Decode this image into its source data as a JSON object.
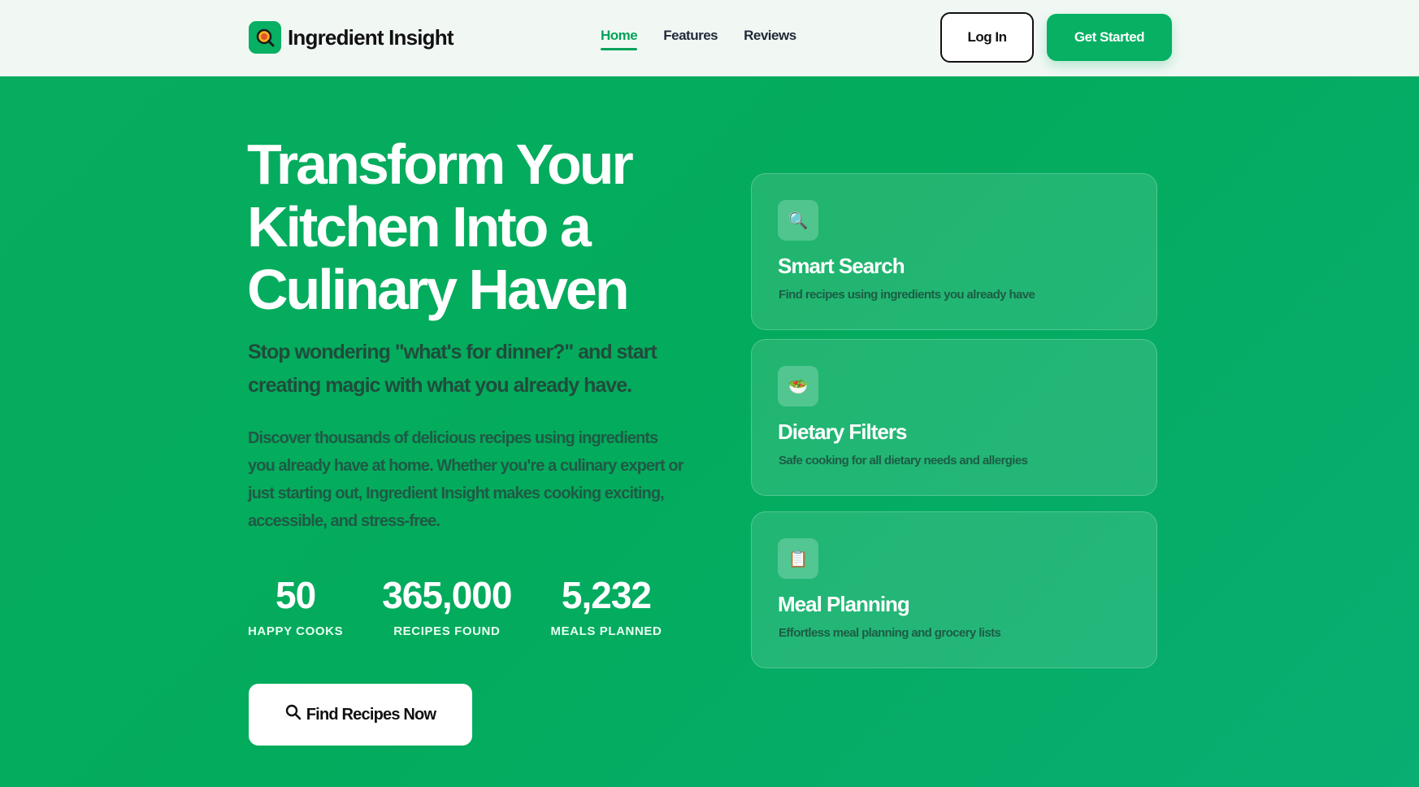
{
  "brand": {
    "name": "Ingredient Insight",
    "logo_icon": "magnifier-icon",
    "accent": "#07b063"
  },
  "nav": {
    "items": [
      {
        "label": "Home",
        "active": true
      },
      {
        "label": "Features",
        "active": false
      },
      {
        "label": "Reviews",
        "active": false
      }
    ]
  },
  "header": {
    "login_label": "Log In",
    "cta_label": "Get Started"
  },
  "hero": {
    "title": "Transform Your Kitchen Into a Culinary Haven",
    "subtitle": "Stop wondering \"what's for dinner?\" and start creating magic with what you already have.",
    "description": "Discover thousands of delicious recipes using ingredients you already have at home. Whether you're a culinary expert or just starting out, Ingredient Insight makes cooking exciting, accessible, and stress-free.",
    "stats": [
      {
        "value": "50",
        "label": "HAPPY COOKS"
      },
      {
        "value": "365,000",
        "label": "RECIPES FOUND"
      },
      {
        "value": "5,232",
        "label": "MEALS PLANNED"
      }
    ],
    "cta_label": "Find Recipes Now",
    "cta_icon": "search-icon"
  },
  "features": [
    {
      "icon": "🔍",
      "icon_name": "magnifying-glass-icon",
      "title": "Smart Search",
      "description": "Find recipes using ingredients you already have"
    },
    {
      "icon": "🥗",
      "icon_name": "salad-icon",
      "title": "Dietary Filters",
      "description": "Safe cooking for all dietary needs and allergies"
    },
    {
      "icon": "📋",
      "icon_name": "clipboard-icon",
      "title": "Meal Planning",
      "description": "Effortless meal planning and grocery lists"
    }
  ]
}
